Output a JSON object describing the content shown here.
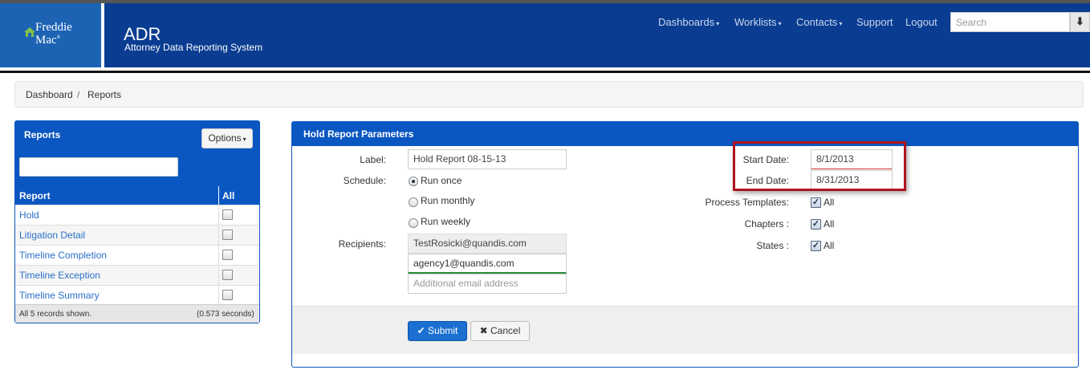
{
  "header": {
    "logo_line1": "Freddie",
    "logo_line2": "Mac",
    "logo_reg": "®",
    "app_title": "ADR",
    "app_subtitle": "Attorney Data Reporting System",
    "nav": {
      "dashboards": "Dashboards",
      "worklists": "Worklists",
      "contacts": "Contacts",
      "support": "Support",
      "logout": "Logout"
    },
    "search_placeholder": "Search"
  },
  "breadcrumb": {
    "dashboard": "Dashboard",
    "separator": "/",
    "reports": "Reports"
  },
  "reports_panel": {
    "title": "Reports",
    "options_label": "Options",
    "col_report": "Report",
    "col_all": "All",
    "items": [
      {
        "label": "Hold"
      },
      {
        "label": "Litigation Detail"
      },
      {
        "label": "Timeline Completion"
      },
      {
        "label": "Timeline Exception"
      },
      {
        "label": "Timeline Summary"
      }
    ],
    "footer_left": "All 5 records shown.",
    "footer_right": "(0.573 seconds)"
  },
  "hold_panel": {
    "title": "Hold Report Parameters",
    "label_label": "Label:",
    "label_value": "Hold Report 08-15-13",
    "schedule_label": "Schedule:",
    "schedule_options": [
      "Run once",
      "Run monthly",
      "Run weekly"
    ],
    "schedule_selected": "Run once",
    "recipients_label": "Recipients:",
    "recipient_fixed": "TestRosicki@quandis.com",
    "recipient_added": "agency1@quandis.com",
    "recipient_placeholder": "Additional email address",
    "start_date_label": "Start Date:",
    "start_date_value": "8/1/2013",
    "end_date_label": "End Date:",
    "end_date_value": "8/31/2013",
    "process_templates_label": "Process Templates:",
    "chapters_label": "Chapters :",
    "states_label": "States :",
    "all_label": "All",
    "submit_label": "Submit",
    "cancel_label": "Cancel"
  },
  "colors": {
    "header_blue": "#0a3d91",
    "panel_blue": "#0a57c2",
    "highlight_red": "#b0121f",
    "link_blue": "#2a6fc9"
  }
}
